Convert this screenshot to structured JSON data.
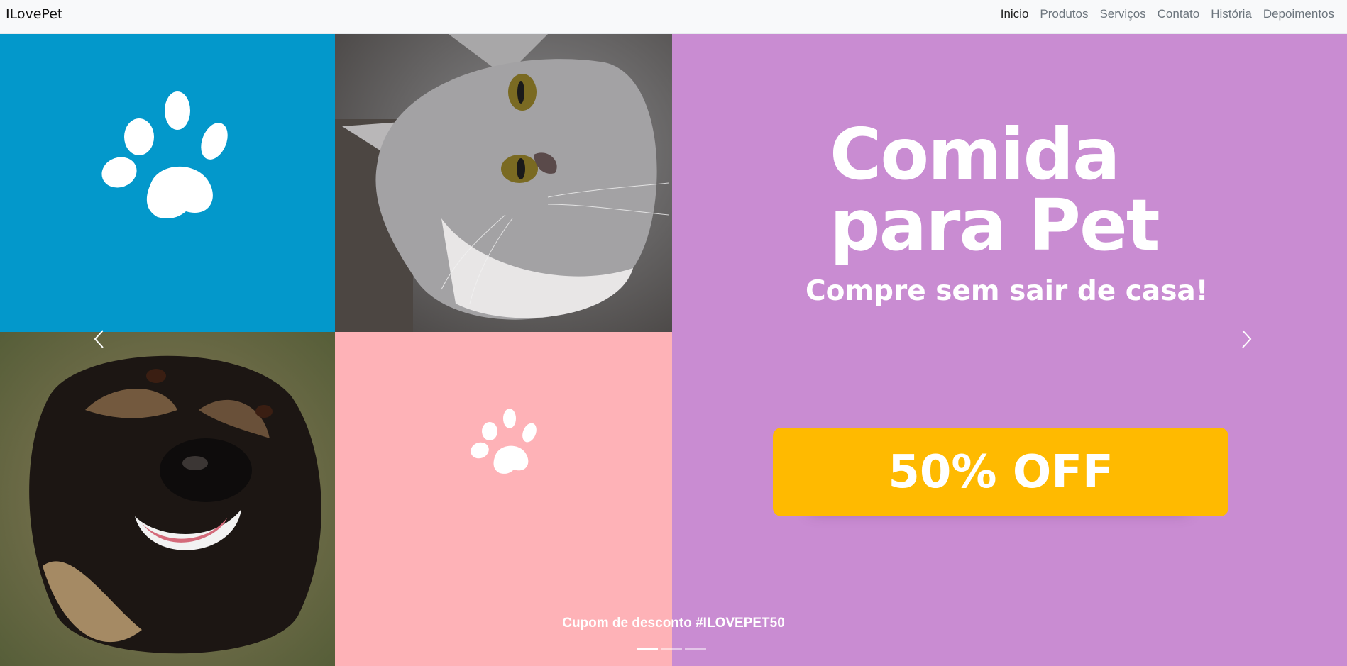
{
  "brand": "ILovePet",
  "nav": {
    "items": [
      {
        "label": "Inicio",
        "active": true
      },
      {
        "label": "Produtos",
        "active": false
      },
      {
        "label": "Serviços",
        "active": false
      },
      {
        "label": "Contato",
        "active": false
      },
      {
        "label": "História",
        "active": false
      },
      {
        "label": "Depoimentos",
        "active": false
      }
    ]
  },
  "carousel": {
    "headline_line1": "Comida",
    "headline_line2": "para Pet",
    "tagline": "Compre sem sair de casa!",
    "offer": "50% OFF",
    "caption": "Cupom de desconto #ILOVEPET50",
    "indicator_count": 3,
    "active_indicator": 0,
    "prev_icon": "chevron-left-icon",
    "next_icon": "chevron-right-icon"
  },
  "colors": {
    "tile_blue": "#0398cb",
    "tile_pink": "#feb2b7",
    "tile_purple": "#c98cd2",
    "offer_badge": "#ffba00"
  }
}
